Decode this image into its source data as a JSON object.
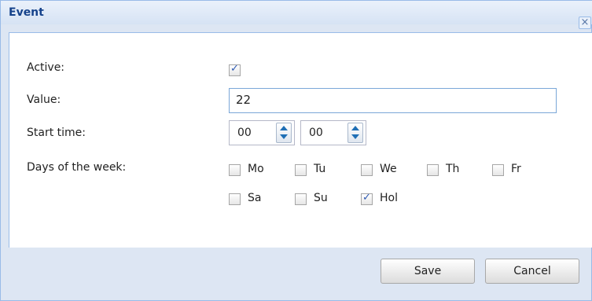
{
  "dialog": {
    "title": "Event",
    "close_symbol": "×"
  },
  "form": {
    "active": {
      "label": "Active:",
      "checked": true
    },
    "value": {
      "label": "Value:",
      "current": "22"
    },
    "start_time": {
      "label": "Start time:",
      "hour": "00",
      "minute": "00"
    },
    "days": {
      "label": "Days of the week:",
      "items": [
        {
          "label": "Mo",
          "checked": false
        },
        {
          "label": "Tu",
          "checked": false
        },
        {
          "label": "We",
          "checked": false
        },
        {
          "label": "Th",
          "checked": false
        },
        {
          "label": "Fr",
          "checked": false
        },
        {
          "label": "Sa",
          "checked": false
        },
        {
          "label": "Su",
          "checked": false
        },
        {
          "label": "Hol",
          "checked": true
        }
      ]
    }
  },
  "buttons": {
    "save": "Save",
    "cancel": "Cancel"
  },
  "colors": {
    "title": "#15428b",
    "window_frame": "#dde6f3",
    "border": "#99bbe8",
    "check": "#2e5ab3"
  },
  "icons": [
    "close-icon",
    "spinner-up-icon",
    "spinner-down-icon",
    "checkmark-icon"
  ]
}
